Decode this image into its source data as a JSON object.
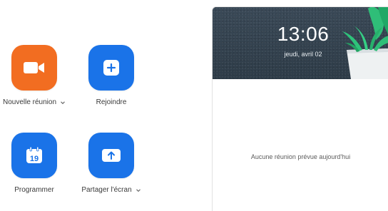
{
  "actions": {
    "new_meeting": {
      "label": "Nouvelle réunion",
      "icon": "video-camera-icon",
      "color": "#f26d21",
      "has_dropdown": true
    },
    "join": {
      "label": "Rejoindre",
      "icon": "plus-icon",
      "color": "#1a73e8",
      "has_dropdown": false
    },
    "schedule": {
      "label": "Programmer",
      "icon": "calendar-icon",
      "calendar_day": "19",
      "color": "#1a73e8",
      "has_dropdown": false
    },
    "share_screen": {
      "label": "Partager l'écran",
      "icon": "share-screen-icon",
      "color": "#1a73e8",
      "has_dropdown": true
    }
  },
  "panel": {
    "time": "13:06",
    "date": "jeudi, avril 02",
    "empty_message": "Aucune réunion prévue aujourd'hui",
    "header_color": "#32424f",
    "decoration_icon": "plant-icon"
  }
}
